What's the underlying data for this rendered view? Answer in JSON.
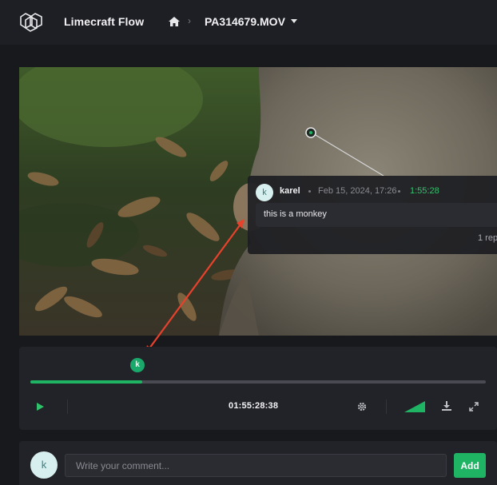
{
  "header": {
    "app_title": "Limecraft Flow",
    "logo_icon": "limecraft-logo-icon",
    "home_icon": "home-icon",
    "breadcrumb_separator": "›",
    "file_name": "PA314679.MOV",
    "file_menu_icon": "caret-down-icon"
  },
  "annotation": {
    "avatar_initial": "k",
    "user": "karel",
    "date": "Feb 15, 2024, 17:26",
    "timecode": "1:55:28",
    "text": "this is a monkey",
    "replies": "1 rep"
  },
  "player": {
    "marker_initial": "k",
    "progress": 0.245,
    "timecode": "01:55:28:38",
    "play_icon": "play-icon",
    "settings_icon": "gear-icon",
    "volume_icon": "volume-icon",
    "download_icon": "download-icon",
    "fullscreen_icon": "fullscreen-icon"
  },
  "comment": {
    "avatar_initial": "k",
    "placeholder": "Write your comment...",
    "add_label": "Add"
  },
  "colors": {
    "accent": "#1eb464",
    "arrow": "#e8412c",
    "background": "#18191d",
    "topbar": "#1e1f24"
  }
}
